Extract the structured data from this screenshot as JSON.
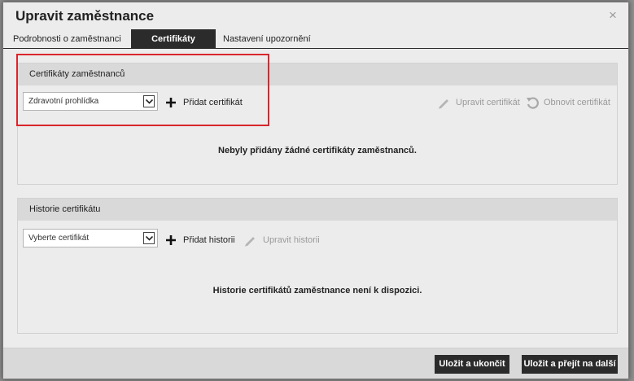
{
  "dialog": {
    "title": "Upravit zaměstnance",
    "close_glyph": "×"
  },
  "tabs": [
    {
      "label": "Podrobnosti o zaměstnanci",
      "active": false
    },
    {
      "label": "Certifikáty",
      "active": true
    },
    {
      "label": "Nastavení upozornění",
      "active": false
    }
  ],
  "certificates": {
    "heading": "Certifikáty zaměstnanců",
    "select_value": "Zdravotní prohlídka",
    "add_label": "Přidat certifikát",
    "edit_label": "Upravit certifikát",
    "renew_label": "Obnovit certifikát",
    "empty_text": "Nebyly přidány žádné certifikáty zaměstnanců."
  },
  "history": {
    "heading": "Historie certifikátu",
    "select_value": "Vyberte certifikát",
    "add_label": "Přidat historii",
    "edit_label": "Upravit historii",
    "empty_text": "Historie certifikátů zaměstnance není k dispozici."
  },
  "footer": {
    "save_close": "Uložit a ukončit",
    "save_next": "Uložit a přejít na další"
  },
  "colors": {
    "active_tab": "#2b2b2b",
    "highlight": "#d9262c",
    "disabled_text": "#9a9a9a"
  },
  "icons": [
    "close-icon",
    "chevron-down-icon",
    "plus-icon",
    "pencil-icon",
    "renew-icon"
  ]
}
